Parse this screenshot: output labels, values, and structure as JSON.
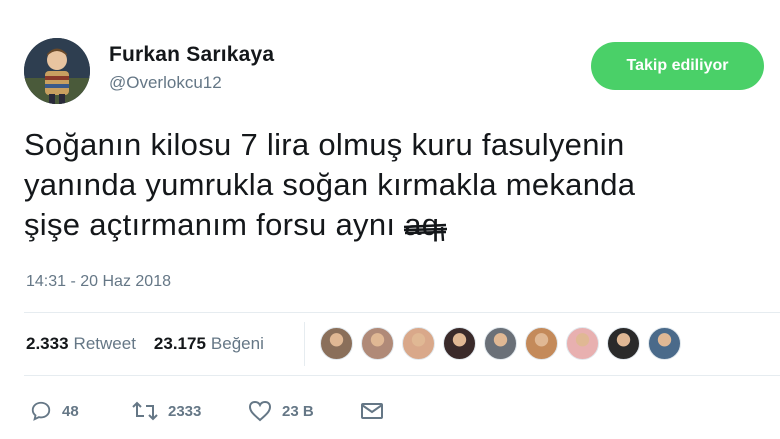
{
  "user": {
    "display_name": "Furkan Sarıkaya",
    "handle": "@Overlokcu12",
    "avatar_icon": "profile-photo"
  },
  "follow_button": {
    "label": "Takip ediliyor",
    "color": "#4ad068"
  },
  "tweet": {
    "line1": "Soğanın kilosu 7 lira olmuş kuru fasulyenin",
    "line2": "yanında yumrukla soğan kırmakla mekanda",
    "line3": "şişe açtırmanım forsu aynı",
    "scribbled_word": "aq"
  },
  "timestamp": "14:31 - 20 Haz 2018",
  "stats": {
    "retweets_count": "2.333",
    "retweets_label": "Retweet",
    "likes_count": "23.175",
    "likes_label": "Beğeni"
  },
  "liker_avatars": [
    {
      "icon": "liker-avatar-1",
      "color": "#8a6f5a"
    },
    {
      "icon": "liker-avatar-2",
      "color": "#b08a78"
    },
    {
      "icon": "liker-avatar-3",
      "color": "#d9a88a"
    },
    {
      "icon": "liker-avatar-4",
      "color": "#3a2a2a"
    },
    {
      "icon": "liker-avatar-5",
      "color": "#6a7078"
    },
    {
      "icon": "liker-avatar-6",
      "color": "#c48a5a"
    },
    {
      "icon": "liker-avatar-7",
      "color": "#e8b0b0"
    },
    {
      "icon": "liker-avatar-8",
      "color": "#2a2a2a"
    },
    {
      "icon": "liker-avatar-9",
      "color": "#4a6a8a"
    }
  ],
  "actions": {
    "reply_count": "48",
    "retweet_count": "2333",
    "like_count": "23 B"
  },
  "colors": {
    "text_primary": "#14171a",
    "text_secondary": "#657786",
    "divider": "#e6ecf0"
  }
}
